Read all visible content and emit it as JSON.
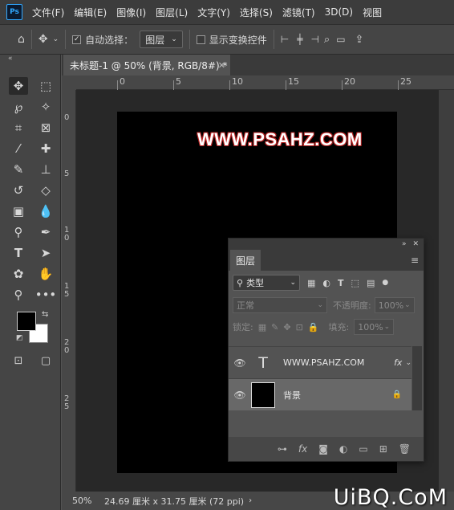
{
  "app": {
    "logo": "Ps"
  },
  "menu": [
    "文件(F)",
    "编辑(E)",
    "图像(I)",
    "图层(L)",
    "文字(Y)",
    "选择(S)",
    "滤镜(T)",
    "3D(D)",
    "视图"
  ],
  "options": {
    "auto_select_label": "自动选择：",
    "auto_select_value": "图层",
    "show_transform_label": "显示变换控件"
  },
  "document": {
    "tab_title": "未标题-1 @ 50% (背景, RGB/8#) *",
    "canvas_text": "WWW.PSAHZ.COM",
    "canvas_text_color": "#ffffff",
    "canvas_text_stroke": "#b52020"
  },
  "ruler": {
    "h_labels": [
      "0",
      "5",
      "10",
      "15",
      "20",
      "25"
    ],
    "v_labels": [
      "0",
      "5",
      "1 0",
      "1 5",
      "2 0",
      "2 5"
    ]
  },
  "status": {
    "zoom": "50%",
    "size": "24.69 厘米 x 31.75 厘米 (72 ppi)"
  },
  "layers_panel": {
    "tab": "图层",
    "filter_kind": "类型",
    "blend_mode": "正常",
    "opacity_label": "不透明度:",
    "opacity_value": "100%",
    "lock_label": "锁定:",
    "fill_label": "填充:",
    "fill_value": "100%",
    "layers": [
      {
        "name": "WWW.PSAHZ.COM",
        "kind": "text",
        "fx": "fx"
      },
      {
        "name": "背景",
        "kind": "background"
      }
    ]
  },
  "colors": {
    "foreground": "#000000",
    "background": "#ffffff",
    "accent": "#31a8ff"
  },
  "watermark": "UiBQ.CoM"
}
